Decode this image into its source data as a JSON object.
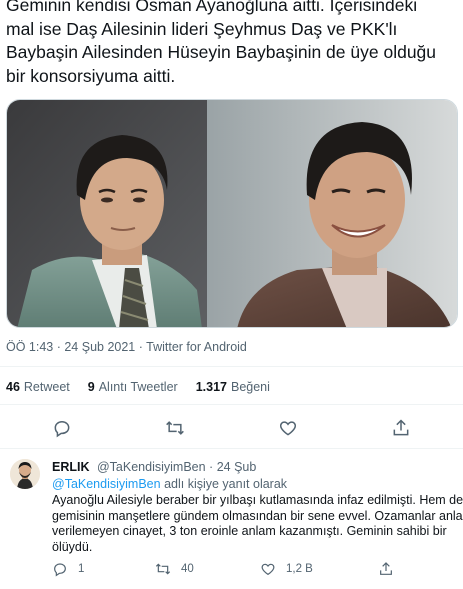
{
  "tweet": {
    "text_lines": [
      "Geminin kendisi Osman Ayanoğluna aitti. İçerisindeki",
      "mal ise Daş Ailesinin lideri Şeyhmus Daş ve PKK'lı",
      "Baybaşin Ailesinden Hüseyin Baybaşinin de üye olduğu",
      "bir konsorsiyuma aitti."
    ],
    "timestamp": "ÖÖ 1:43 · 24 Şub 2021 · Twitter for Android",
    "stats": {
      "retweets_count": "46",
      "retweets_label": "Retweet",
      "quotes_count": "9",
      "quotes_label": "Alıntı Tweetler",
      "likes_count": "1.317",
      "likes_label": "Beğeni"
    },
    "actions": [
      "reply-icon",
      "retweet-icon",
      "like-icon",
      "share-icon"
    ]
  },
  "reply": {
    "author_name": "ERLIK",
    "author_handle": "@TaKendisiyimBen",
    "separator": "·",
    "date": "24 Şub",
    "reply_to_mention": "@TaKendisiyimBen",
    "reply_to_suffix": "adlı kişiye yanıt olarak",
    "body_lines": [
      "Ayanoğlu Ailesiyle beraber bir yılbaşı kutlamasında infaz edilmişti. Hem de",
      "gemisinin manşetlere gündem olmasından bir sene evvel. Ozamanlar anlam",
      "verilemeyen cinayet, 3 ton eroinle anlam kazanmıştı. Geminin sahibi bir",
      "ölüydü."
    ],
    "counts": {
      "replies": "1",
      "retweets": "40",
      "likes": "1,2 B"
    }
  },
  "colors": {
    "text_primary": "#0f1419",
    "text_secondary": "#536471",
    "link": "#1d9bf0",
    "divider": "#eff3f4"
  }
}
